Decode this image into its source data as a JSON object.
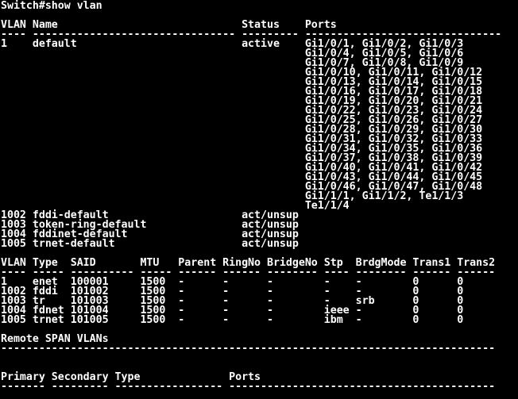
{
  "terminal": {
    "background": "#000000",
    "foreground": "#ffffff",
    "lines": [
      "Switch#show vlan",
      "",
      "VLAN Name                             Status    Ports",
      "---- -------------------------------- --------- -------------------------------",
      "1    default                          active    Gi1/0/1, Gi1/0/2, Gi1/0/3",
      "                                                Gi1/0/4, Gi1/0/5, Gi1/0/6",
      "                                                Gi1/0/7, Gi1/0/8, Gi1/0/9",
      "                                                Gi1/0/10, Gi1/0/11, Gi1/0/12",
      "                                                Gi1/0/13, Gi1/0/14, Gi1/0/15",
      "                                                Gi1/0/16, Gi1/0/17, Gi1/0/18",
      "                                                Gi1/0/19, Gi1/0/20, Gi1/0/21",
      "                                                Gi1/0/22, Gi1/0/23, Gi1/0/24",
      "                                                Gi1/0/25, Gi1/0/26, Gi1/0/27",
      "                                                Gi1/0/28, Gi1/0/29, Gi1/0/30",
      "                                                Gi1/0/31, Gi1/0/32, Gi1/0/33",
      "                                                Gi1/0/34, Gi1/0/35, Gi1/0/36",
      "                                                Gi1/0/37, Gi1/0/38, Gi1/0/39",
      "                                                Gi1/0/40, Gi1/0/41, Gi1/0/42",
      "                                                Gi1/0/43, Gi1/0/44, Gi1/0/45",
      "                                                Gi1/0/46, Gi1/0/47, Gi1/0/48",
      "                                                Gi1/1/1, Gi1/1/2, Te1/1/3",
      "                                                Te1/1/4",
      "1002 fddi-default                     act/unsup",
      "1003 token-ring-default               act/unsup",
      "1004 fddinet-default                  act/unsup",
      "1005 trnet-default                    act/unsup",
      "",
      "VLAN Type  SAID       MTU   Parent RingNo BridgeNo Stp  BrdgMode Trans1 Trans2",
      "---- ----- ---------- ----- ------ ------ -------- ---- -------- ------ ------",
      "1    enet  100001     1500  -      -      -        -    -        0      0",
      "1002 fddi  101002     1500  -      -      -        -    -        0      0",
      "1003 tr    101003     1500  -      -      -        -    srb      0      0",
      "1004 fdnet 101004     1500  -      -      -        ieee -        0      0",
      "1005 trnet 101005     1500  -      -      -        ibm  -        0      0",
      "",
      "Remote SPAN VLANs",
      "------------------------------------------------------------------------------",
      "",
      "",
      "Primary Secondary Type              Ports",
      "------- --------- ----------------- ------------------------------------------"
    ]
  }
}
